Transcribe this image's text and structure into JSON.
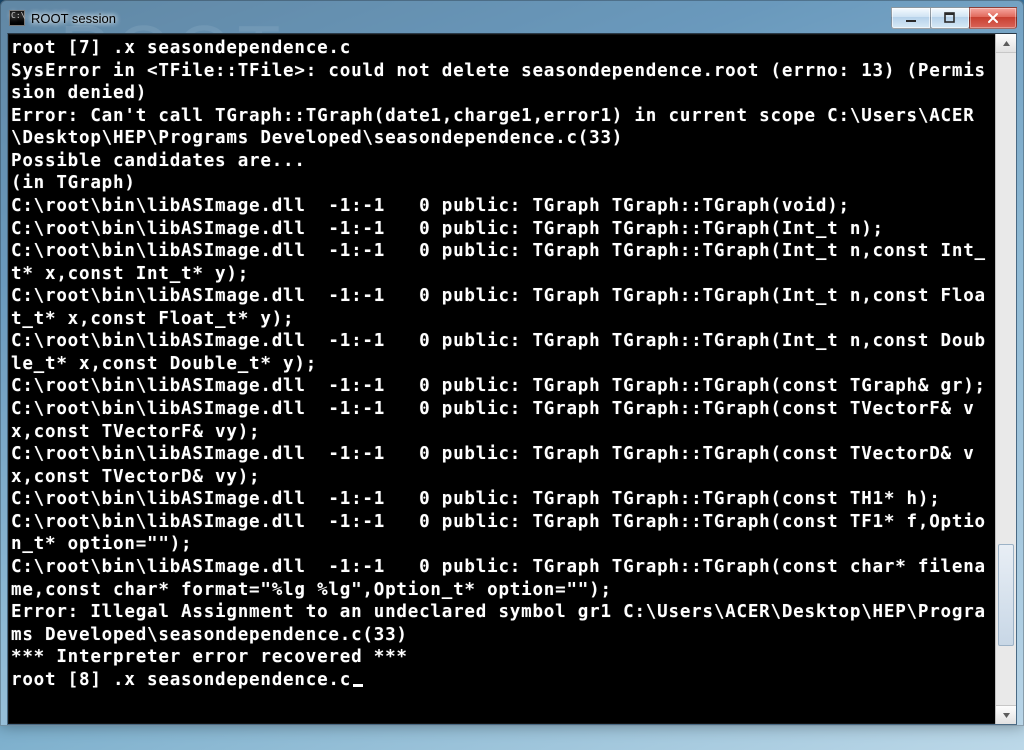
{
  "window": {
    "title": "ROOT session"
  },
  "console": {
    "lines": [
      "root [7] .x seasondependence.c",
      "SysError in <TFile::TFile>: could not delete seasondependence.root (errno: 13) (Permission denied)",
      "Error: Can't call TGraph::TGraph(date1,charge1,error1) in current scope C:\\Users\\ACER\\Desktop\\HEP\\Programs Developed\\seasondependence.c(33)",
      "Possible candidates are...",
      "(in TGraph)",
      "C:\\root\\bin\\libASImage.dll  -1:-1   0 public: TGraph TGraph::TGraph(void);",
      "C:\\root\\bin\\libASImage.dll  -1:-1   0 public: TGraph TGraph::TGraph(Int_t n);",
      "C:\\root\\bin\\libASImage.dll  -1:-1   0 public: TGraph TGraph::TGraph(Int_t n,const Int_t* x,const Int_t* y);",
      "C:\\root\\bin\\libASImage.dll  -1:-1   0 public: TGraph TGraph::TGraph(Int_t n,const Float_t* x,const Float_t* y);",
      "C:\\root\\bin\\libASImage.dll  -1:-1   0 public: TGraph TGraph::TGraph(Int_t n,const Double_t* x,const Double_t* y);",
      "C:\\root\\bin\\libASImage.dll  -1:-1   0 public: TGraph TGraph::TGraph(const TGraph& gr);",
      "C:\\root\\bin\\libASImage.dll  -1:-1   0 public: TGraph TGraph::TGraph(const TVectorF& vx,const TVectorF& vy);",
      "C:\\root\\bin\\libASImage.dll  -1:-1   0 public: TGraph TGraph::TGraph(const TVectorD& vx,const TVectorD& vy);",
      "C:\\root\\bin\\libASImage.dll  -1:-1   0 public: TGraph TGraph::TGraph(const TH1* h);",
      "C:\\root\\bin\\libASImage.dll  -1:-1   0 public: TGraph TGraph::TGraph(const TF1* f,Option_t* option=\"\");",
      "C:\\root\\bin\\libASImage.dll  -1:-1   0 public: TGraph TGraph::TGraph(const char* filename,const char* format=\"%lg %lg\",Option_t* option=\"\");",
      "Error: Illegal Assignment to an undeclared symbol gr1 C:\\Users\\ACER\\Desktop\\HEP\\Programs Developed\\seasondependence.c(33)",
      "*** Interpreter error recovered ***"
    ],
    "prompt": "root [8] .x seasondependence.c"
  }
}
